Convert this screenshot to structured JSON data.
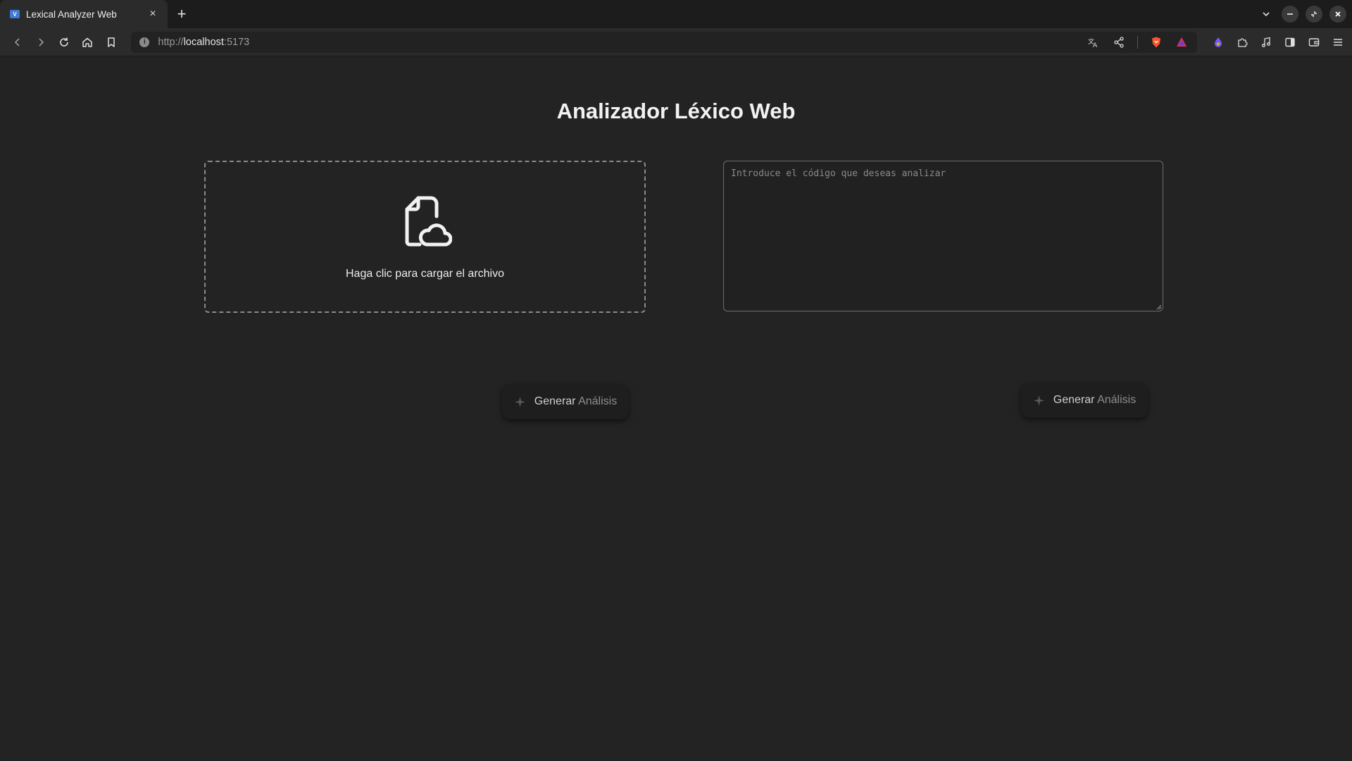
{
  "browser": {
    "tab_title": "Lexical Analyzer Web",
    "favicon_text": "V",
    "url_scheme": "http://",
    "url_host": "localhost",
    "url_port": ":5173"
  },
  "page": {
    "title": "Analizador Léxico Web",
    "upload": {
      "label": "Haga clic para cargar el archivo",
      "icon": "file-cloud-upload-icon"
    },
    "code_input": {
      "placeholder": "Introduce el código que deseas analizar",
      "value": ""
    },
    "generate_button_left": {
      "label_part1": "Generar ",
      "label_part2": "Análisis"
    },
    "generate_button_right": {
      "label_part1": "Generar ",
      "label_part2": "Análisis"
    }
  },
  "colors": {
    "background": "#232323",
    "chrome": "#2b2b2b",
    "brave_orange": "#fb542b"
  }
}
